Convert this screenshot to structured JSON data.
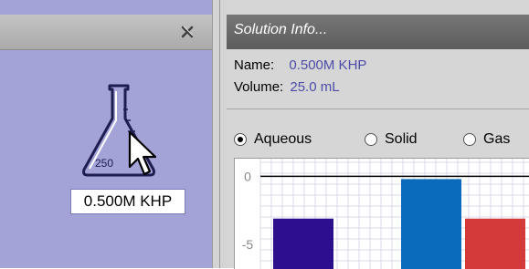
{
  "left_panel": {
    "flask_label": "0.500M KHP",
    "flask_volume_mark": "250",
    "close_icon": "close-icon"
  },
  "solution_info": {
    "title": "Solution Info...",
    "name_label": "Name:",
    "name_value": "0.500M KHP",
    "volume_label": "Volume:",
    "volume_value": "25.0 mL"
  },
  "phase_options": [
    {
      "label": "Aqueous",
      "selected": true
    },
    {
      "label": "Solid",
      "selected": false
    },
    {
      "label": "Gas",
      "selected": false
    }
  ],
  "chart_data": {
    "type": "bar",
    "y_tick_labels": [
      "0",
      "-5"
    ],
    "ylim": [
      -6.8,
      1.3
    ],
    "grid": true,
    "series": [
      {
        "color": "#2b0f8c",
        "value": -3.1
      },
      {
        "color": "#0a6bbd",
        "value": -0.2
      },
      {
        "color": "#d43a3a",
        "value": -3.1
      }
    ]
  }
}
